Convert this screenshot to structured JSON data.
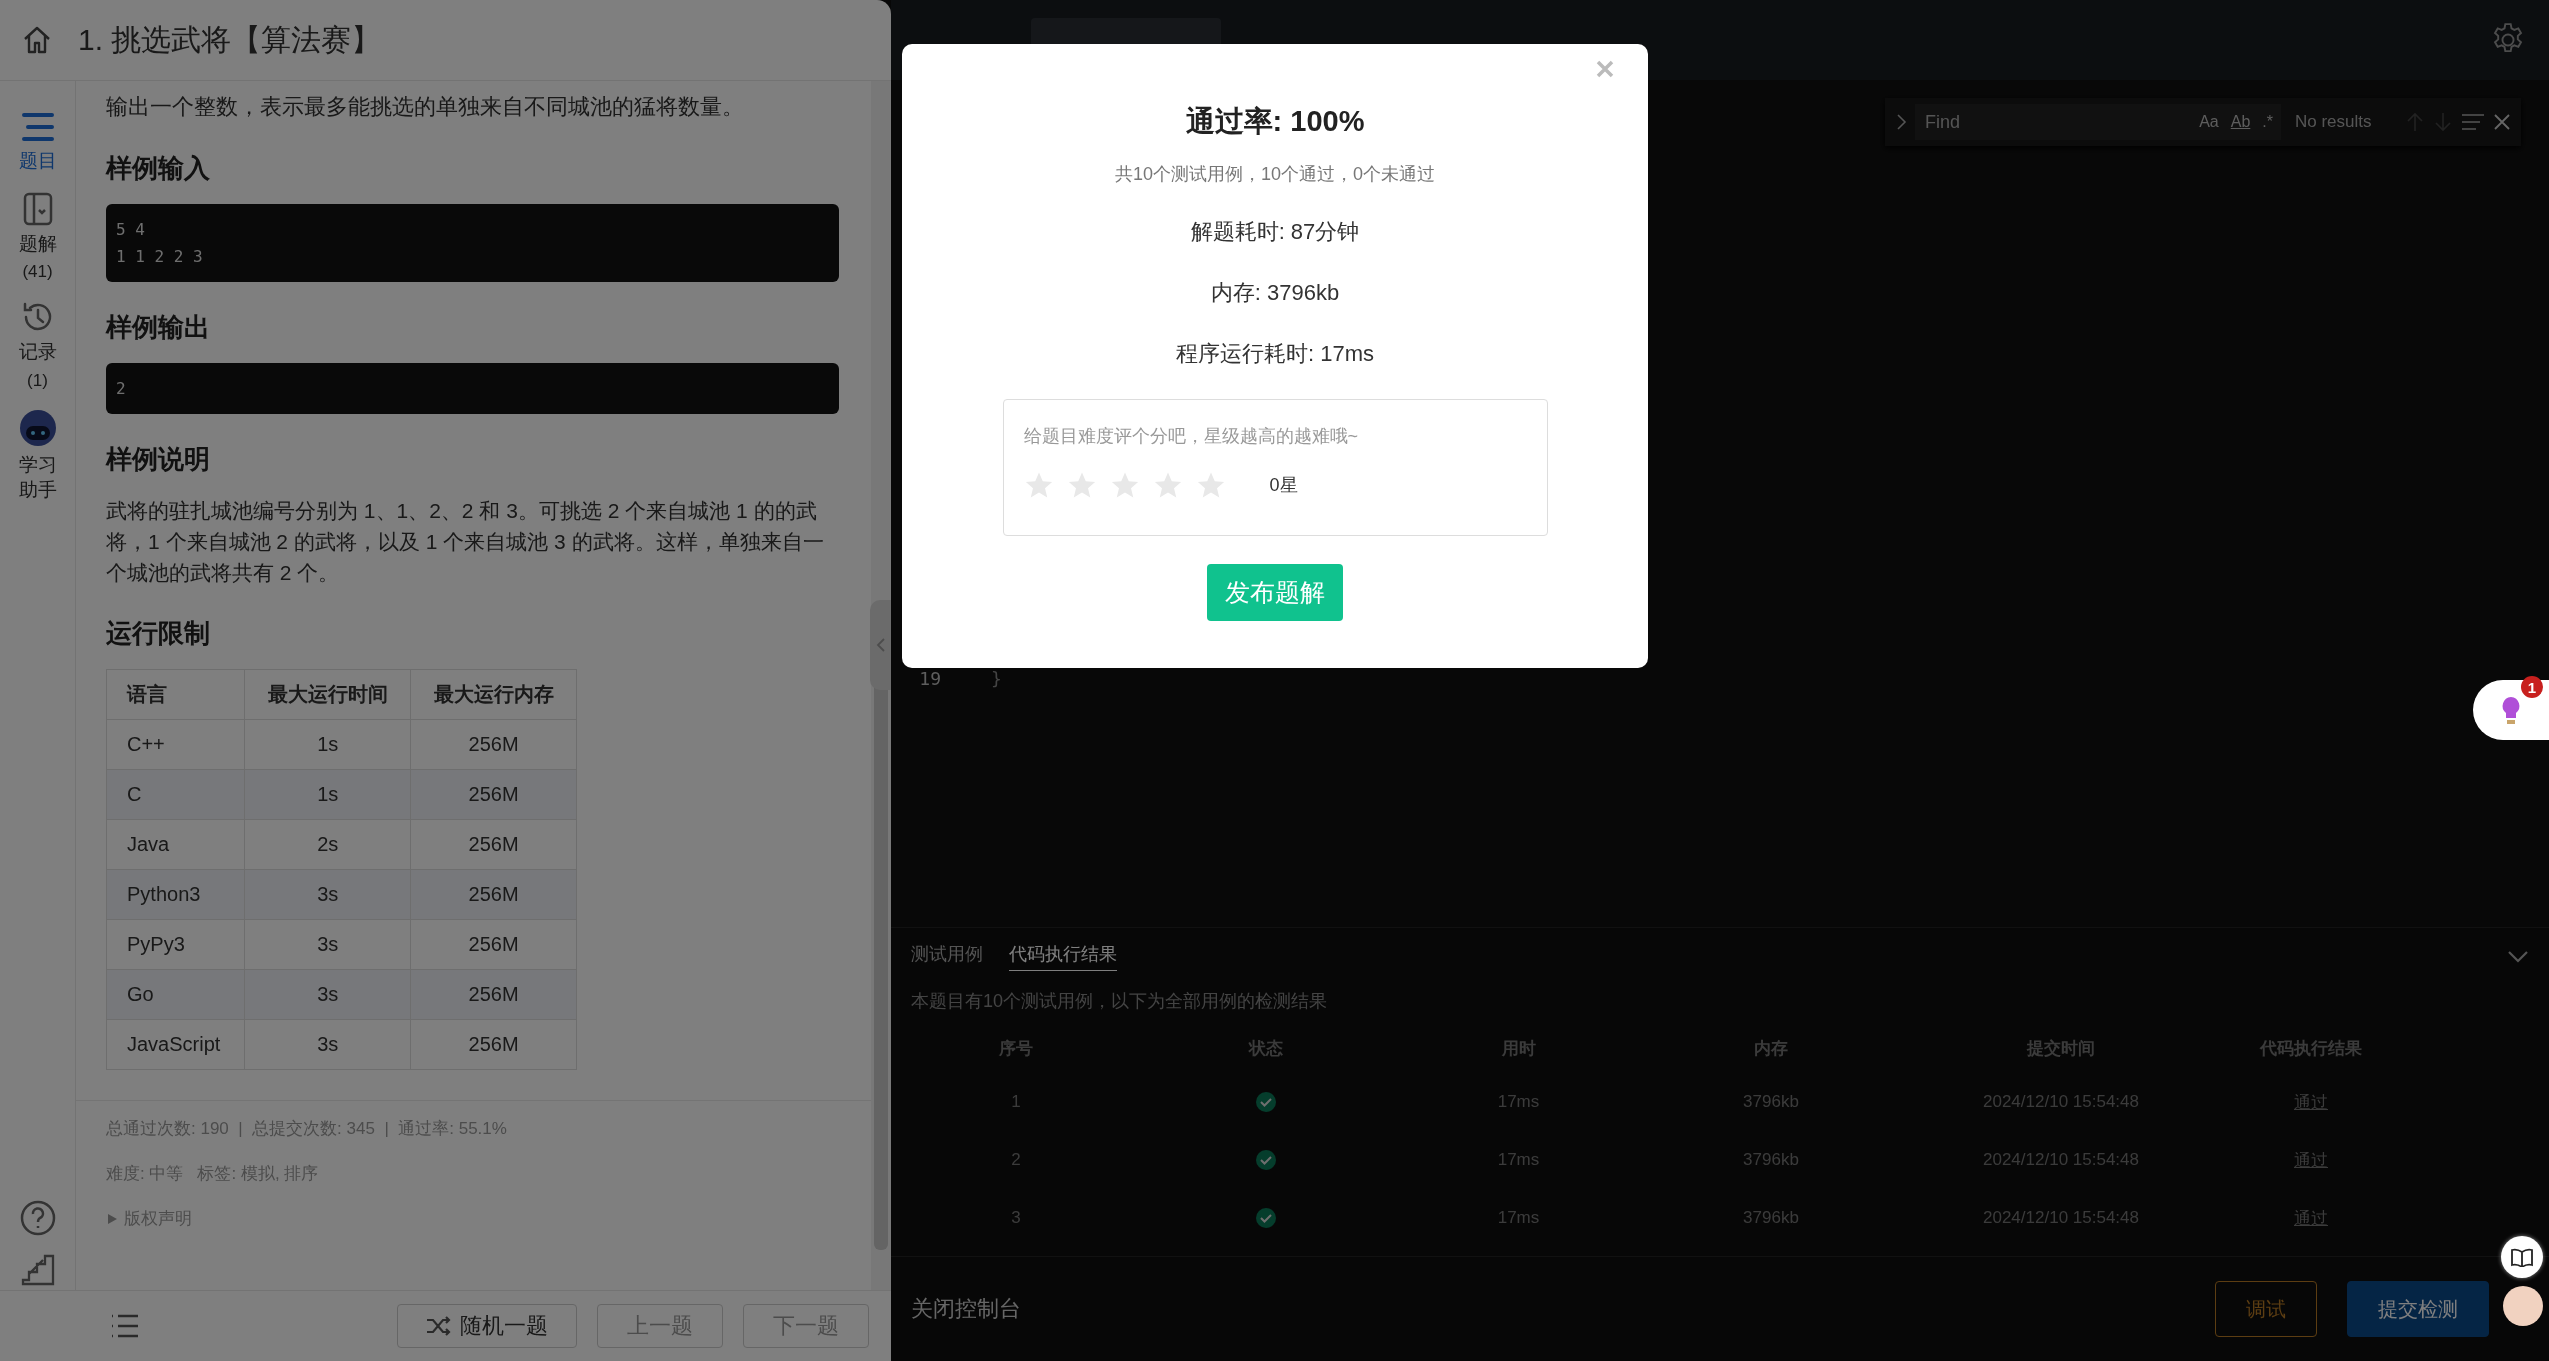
{
  "problem": {
    "title": "1. 挑选武将【算法赛】"
  },
  "sidebar": {
    "items": [
      {
        "label": "题目",
        "kind": "list",
        "selected": true
      },
      {
        "label": "题解",
        "count": "(41)",
        "kind": "book",
        "selected": false
      },
      {
        "label": "记录",
        "count": "(1)",
        "kind": "history",
        "selected": false
      },
      {
        "label": "学习助手",
        "kind": "robot",
        "selected": false
      }
    ]
  },
  "content": {
    "intro": "输出一个整数，表示最多能挑选的单独来自不同城池的猛将数量。",
    "sections": [
      {
        "heading": "样例输入",
        "kind": "code",
        "lines": [
          "5 4",
          "1 1 2 2 3"
        ]
      },
      {
        "heading": "样例输出",
        "kind": "code",
        "lines": [
          "2"
        ]
      },
      {
        "heading": "样例说明",
        "kind": "text",
        "text": "武将的驻扎城池编号分别为 1、1、2、2 和 3。可挑选 2 个来自城池 1 的的武将，1 个来自城池 2 的武将，以及 1 个来自城池 3 的武将。这样，单独来自一个城池的武将共有 2 个。"
      },
      {
        "heading": "运行限制",
        "kind": "table",
        "columns": [
          "语言",
          "最大运行时间",
          "最大运行内存"
        ],
        "rows": [
          [
            "C++",
            "1s",
            "256M"
          ],
          [
            "C",
            "1s",
            "256M"
          ],
          [
            "Java",
            "2s",
            "256M"
          ],
          [
            "Python3",
            "3s",
            "256M"
          ],
          [
            "PyPy3",
            "3s",
            "256M"
          ],
          [
            "Go",
            "3s",
            "256M"
          ],
          [
            "JavaScript",
            "3s",
            "256M"
          ]
        ]
      }
    ]
  },
  "stats": "总通过次数: 190  |  总提交次数: 345  |  通过率: 55.1%",
  "difficulty": "难度: 中等",
  "tags": "标签: 模拟, 排序",
  "copyright": {
    "label": "版权声明",
    "expanded": false
  },
  "footer_buttons": [
    {
      "label": "随机一题",
      "kind": "random"
    },
    {
      "label": "上一题",
      "kind": "plain"
    },
    {
      "label": "下一题",
      "kind": "plain"
    }
  ],
  "editor": {
    "find": {
      "placeholder": "Find",
      "options": [
        "Aa",
        "Ab",
        ".*"
      ],
      "status": "No results"
    },
    "lines": [
      {
        "number": "19",
        "code": "}"
      }
    ]
  },
  "modal": {
    "title": "通过率: **100%**",
    "summary": "共10个测试用例，10个通过，0个未通过",
    "details": [
      "解题耗时: 87分钟",
      "内存: 3796kb",
      "程序运行耗时: 17ms"
    ],
    "rating": {
      "prompt": "给题目难度评个分吧，星级越高的越难哦~",
      "stars": 0,
      "label": "0星"
    },
    "button": "发布题解"
  },
  "console": {
    "tabs": [
      {
        "label": "测试用例",
        "selected": false
      },
      {
        "label": "代码执行结果",
        "selected": true
      }
    ],
    "description": "本题目有10个测试用例，以下为全部用例的检测结果",
    "columns": [
      "序号",
      "状态",
      "用时",
      "内存",
      "提交时间",
      "代码执行结果"
    ],
    "rows": [
      {
        "index": "1",
        "passed": true,
        "time": "17ms",
        "memory": "3796kb",
        "submitted": "2024/12/10 15:54:48",
        "result": "通过"
      },
      {
        "index": "2",
        "passed": true,
        "time": "17ms",
        "memory": "3796kb",
        "submitted": "2024/12/10 15:54:48",
        "result": "通过"
      },
      {
        "index": "3",
        "passed": true,
        "time": "17ms",
        "memory": "3796kb",
        "submitted": "2024/12/10 15:54:48",
        "result": "通过"
      }
    ],
    "close_label": "关闭控制台",
    "buttons": [
      {
        "label": "调试",
        "kind": "debug"
      },
      {
        "label": "提交检测",
        "kind": "submit"
      }
    ]
  },
  "hint_badge": "1"
}
